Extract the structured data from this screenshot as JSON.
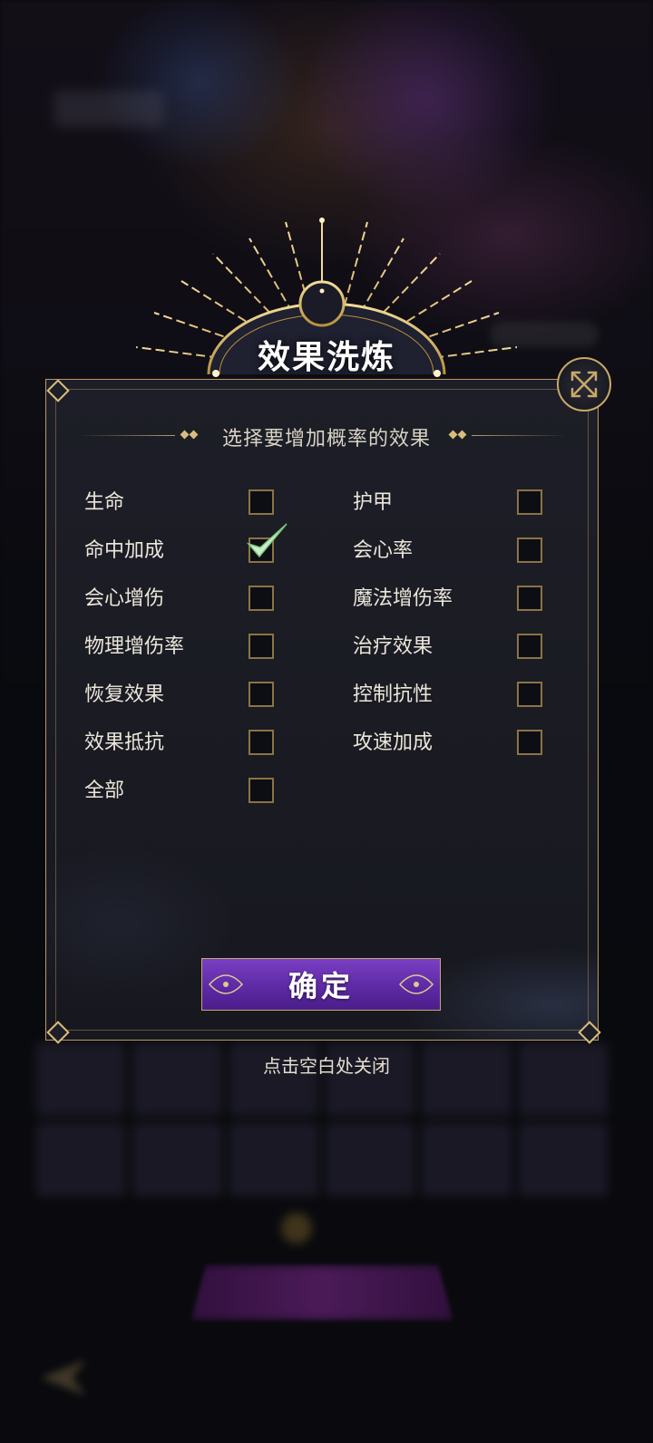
{
  "dialog": {
    "title": "效果洗炼",
    "subtitle": "选择要增加概率的效果",
    "confirm_label": "确定",
    "dismiss_hint": "点击空白处关闭"
  },
  "options": {
    "left": [
      {
        "label": "生命",
        "checked": false
      },
      {
        "label": "命中加成",
        "checked": true
      },
      {
        "label": "会心增伤",
        "checked": false
      },
      {
        "label": "物理增伤率",
        "checked": false
      },
      {
        "label": "恢复效果",
        "checked": false
      },
      {
        "label": "效果抵抗",
        "checked": false
      },
      {
        "label": "全部",
        "checked": false
      }
    ],
    "right": [
      {
        "label": "护甲",
        "checked": false
      },
      {
        "label": "会心率",
        "checked": false
      },
      {
        "label": "魔法增伤率",
        "checked": false
      },
      {
        "label": "治疗效果",
        "checked": false
      },
      {
        "label": "控制抗性",
        "checked": false
      },
      {
        "label": "攻速加成",
        "checked": false
      }
    ]
  },
  "colors": {
    "gold": "#c8a96a",
    "check": "#c8f0c8",
    "button_purple": "#6a33b3"
  }
}
